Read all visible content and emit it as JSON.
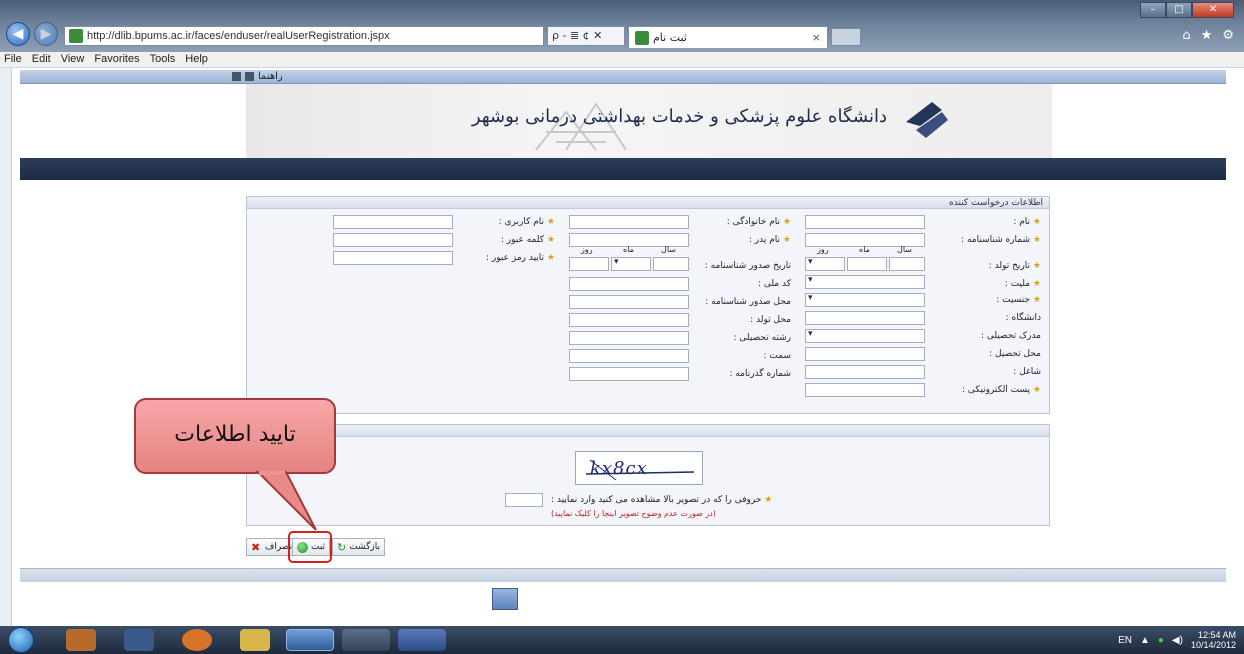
{
  "browser": {
    "url": "http://dlib.bpums.ac.ir/faces/enduser/realUserRegistration.jspx",
    "address_tools": "ρ - ≣ ¢ ✕",
    "tab_title": "ثبت نام",
    "tab_close": "×",
    "window_controls": [
      "–",
      "□",
      "✕"
    ],
    "right_icons": [
      "home-icon",
      "star-icon",
      "gear-icon"
    ]
  },
  "menu": [
    "File",
    "Edit",
    "View",
    "Favorites",
    "Tools",
    "Help"
  ],
  "header": {
    "help_label": "راهنما",
    "university_name": "دانشگاه علوم پزشکی و خدمات بهداشتی درمانی بوشهر"
  },
  "form": {
    "panel_title": "اطلاعات درخواست کننده",
    "col_right": [
      "نام :",
      "شماره شناسنامه :",
      "تاریخ تولد :",
      "ملیت :",
      "جنسیت :",
      "دانشگاه :",
      "مدرک تحصیلی :",
      "محل تحصیل :",
      "شاغل :",
      "پست الکترونیکی :"
    ],
    "col_middle": [
      "نام خانوادگی :",
      "نام پدر :",
      "تاریخ صدور شناسنامه :",
      "کد ملی :",
      "محل صدور شناسنامه :",
      "محل تولد :",
      "رشته تحصیلی :",
      "سمت :",
      "شماره گذرنامه :"
    ],
    "col_left": [
      "نام کاربری :",
      "کلمه عبور :",
      "تایید رمز عبور :"
    ],
    "date_headers": [
      "روز",
      "ماه",
      "سال"
    ]
  },
  "captcha": {
    "image_text": "kx8cx",
    "prompt": "حروفی را که در تصویر بالا مشاهده می کنید وارد نمایید :",
    "note": "(در صورت عدم وضوح تصویر اینجا را کلیک نمایید)"
  },
  "buttons": {
    "cancel": "انصراف",
    "confirm": "ثبت",
    "back": "بازگشت"
  },
  "callout": {
    "text": "تایید اطلاعات"
  },
  "taskbar": {
    "lang": "EN",
    "time": "12:54 AM",
    "date": "10/14/2012"
  }
}
